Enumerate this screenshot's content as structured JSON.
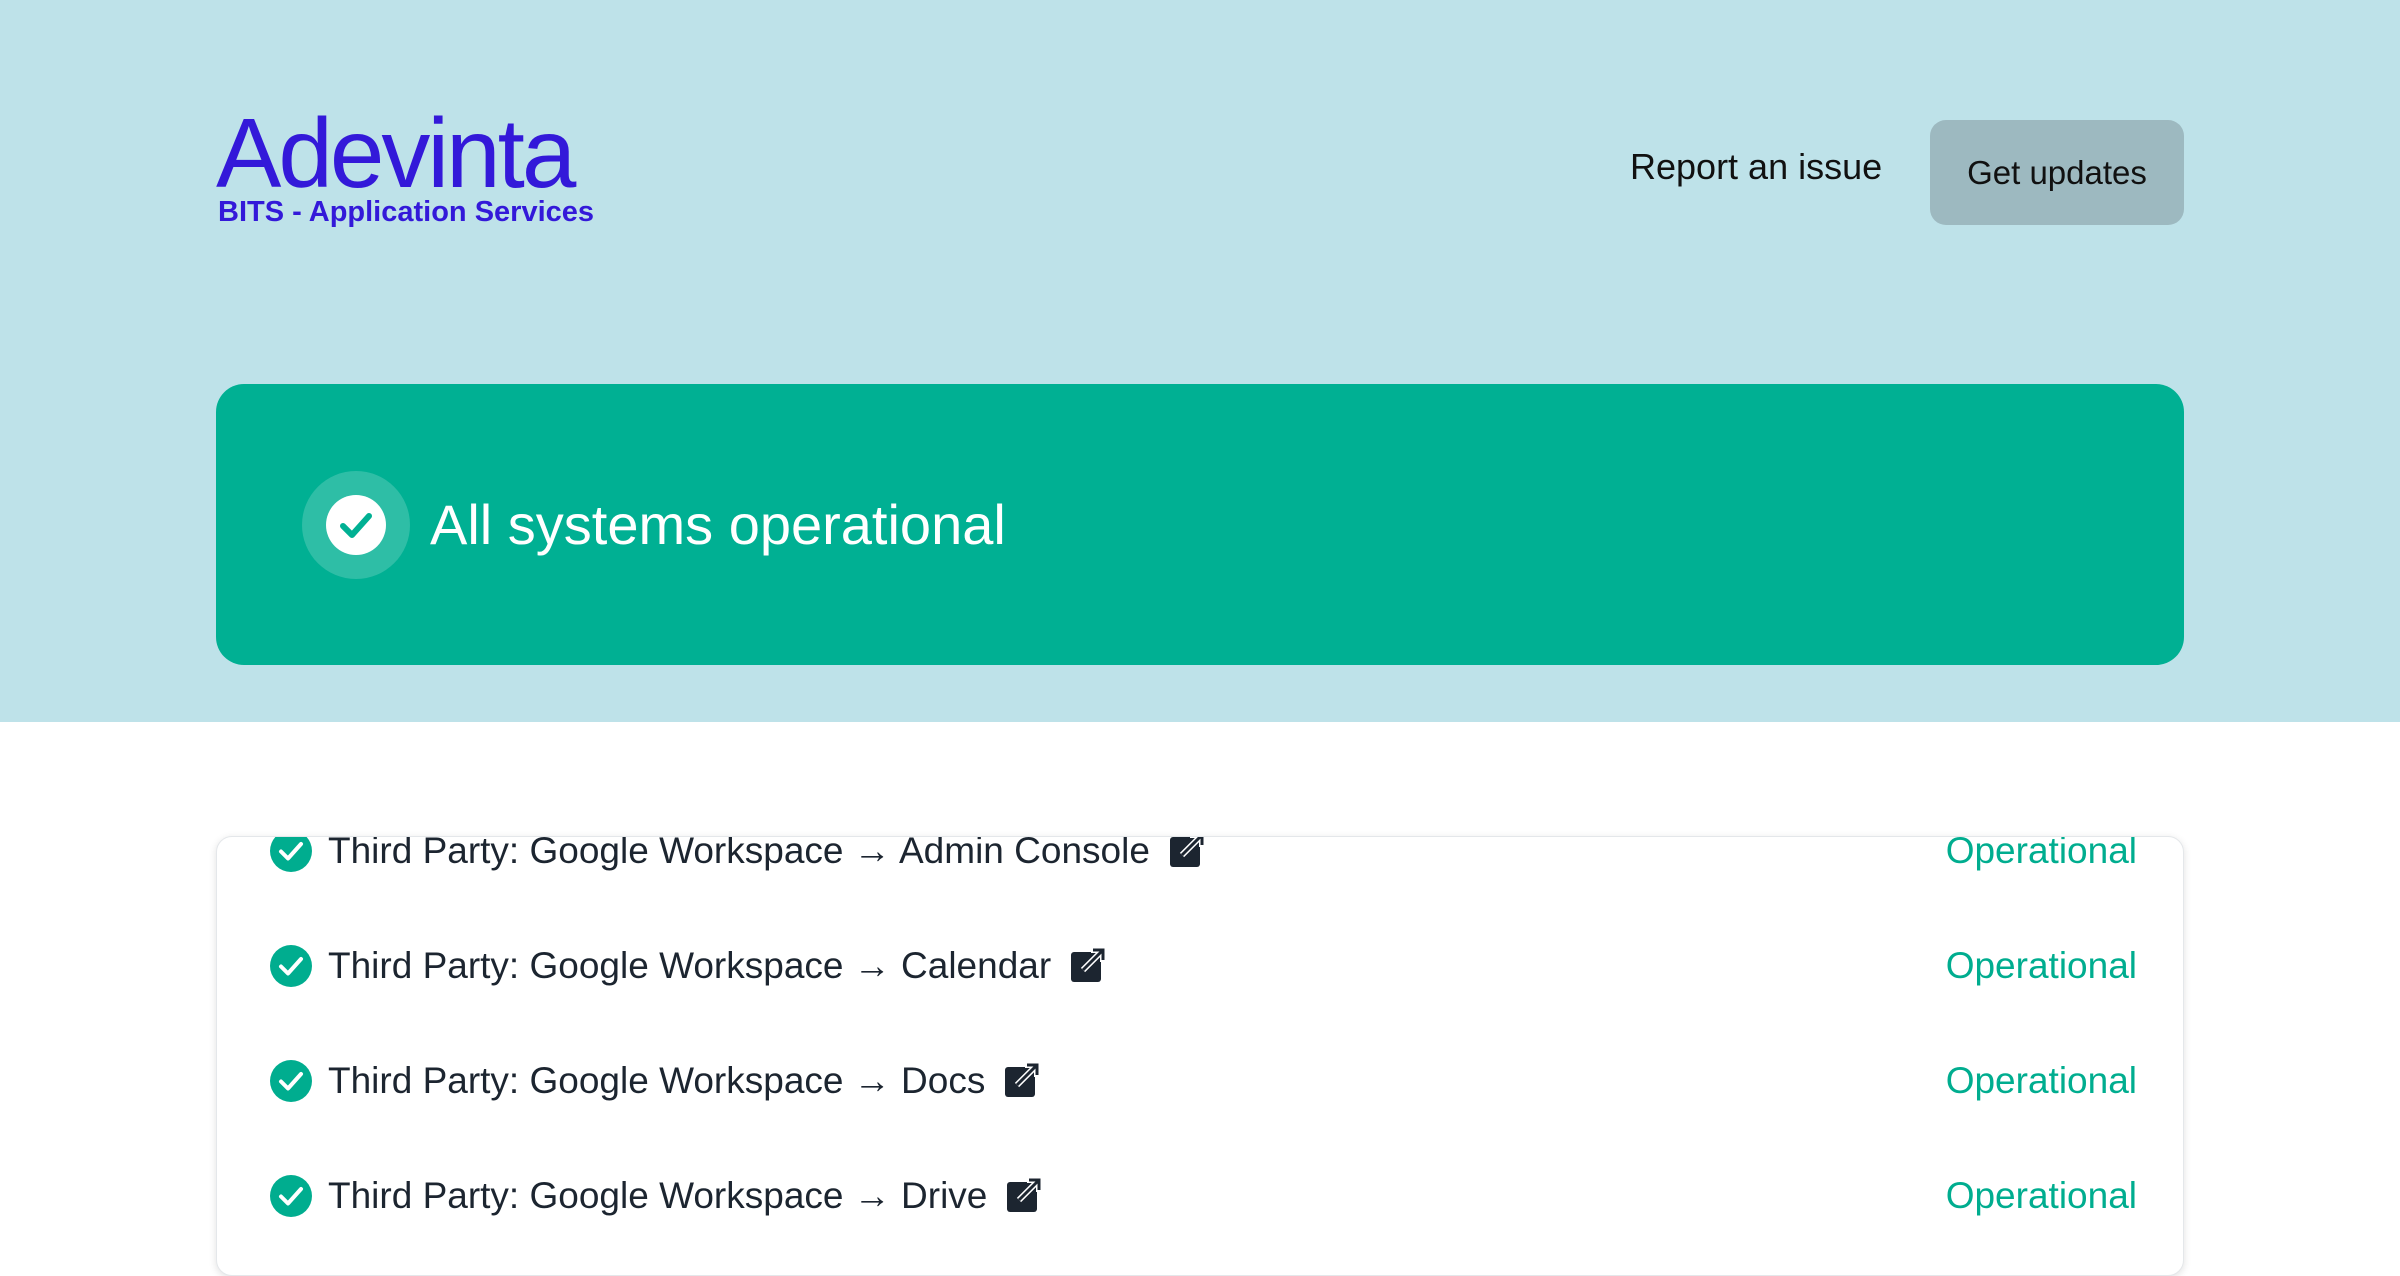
{
  "brand": {
    "logo_word": "Adevinta",
    "logo_subtitle": "BITS - Application Services",
    "logo_color": "#3319d9"
  },
  "header": {
    "report_label": "Report an issue",
    "updates_label": "Get updates"
  },
  "status": {
    "summary": "All systems operational",
    "color": "#00b093"
  },
  "components": [
    {
      "name": "Third Party: Google Workspace → Admin Console",
      "status": "Operational",
      "icon": "external-link-icon"
    },
    {
      "name": "Third Party: Google Workspace → Calendar",
      "status": "Operational",
      "icon": "external-link-icon"
    },
    {
      "name": "Third Party: Google Workspace → Docs",
      "status": "Operational",
      "icon": "external-link-icon"
    },
    {
      "name": "Third Party: Google Workspace → Drive",
      "status": "Operational",
      "icon": "external-link-icon"
    }
  ],
  "colors": {
    "hero_bg": "#bee2e9",
    "operational": "#00ad8f",
    "button_bg": "#9db9c0"
  }
}
